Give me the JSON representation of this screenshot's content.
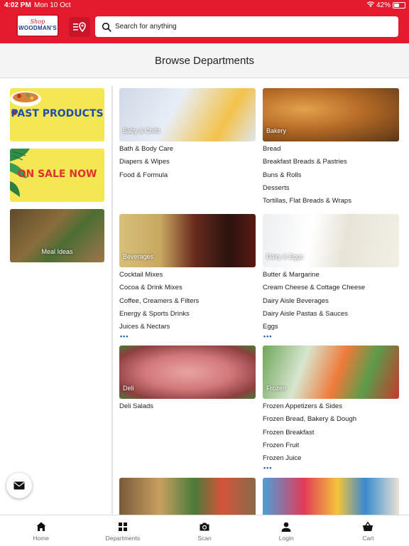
{
  "status_bar": {
    "time": "4:02 PM",
    "date": "Mon 10 Oct",
    "battery": "42%"
  },
  "header": {
    "logo": {
      "tagline": "Shop",
      "brand": "WOODMAN'S"
    },
    "search": {
      "placeholder": "Search for anything"
    }
  },
  "page_title": "Browse Departments",
  "sidebar": {
    "promos": [
      {
        "label": "PAST PRODUCTS",
        "color": "#1e4fb0"
      },
      {
        "label": "ON SALE NOW",
        "color": "#e0302f"
      }
    ],
    "meal_ideas": {
      "label": "Meal Ideas"
    }
  },
  "departments": [
    {
      "name": "Baby & Child",
      "items": [
        "Bath & Body Care",
        "Diapers & Wipes",
        "Food & Formula"
      ],
      "more": ""
    },
    {
      "name": "Bakery",
      "items": [
        "Bread",
        "Breakfast Breads & Pastries",
        "Buns & Rolls",
        "Desserts",
        "Tortillas, Flat Breads & Wraps"
      ],
      "more": ""
    },
    {
      "name": "Beverages",
      "items": [
        "Cocktail Mixes",
        "Cocoa & Drink Mixes",
        "Coffee, Creamers & Filters",
        "Energy & Sports Drinks",
        "Juices & Nectars"
      ],
      "more": "•••"
    },
    {
      "name": "Dairy & Eggs",
      "items": [
        "Butter & Margarine",
        "Cream Cheese & Cottage Cheese",
        "Dairy Aisle Beverages",
        "Dairy Aisle Pastas & Sauces",
        "Eggs"
      ],
      "more": "•••"
    },
    {
      "name": "Deli",
      "items": [
        "Deli Salads"
      ],
      "more": ""
    },
    {
      "name": "Frozen",
      "items": [
        "Frozen Appetizers & Sides",
        "Frozen Bread, Bakery & Dough",
        "Frozen Breakfast",
        "Frozen Fruit",
        "Frozen Juice"
      ],
      "more": "•••"
    }
  ],
  "tabbar": {
    "tabs": [
      {
        "label": "Home",
        "icon": "home-icon"
      },
      {
        "label": "Departments",
        "icon": "grid-icon"
      },
      {
        "label": "Scan",
        "icon": "camera-icon"
      },
      {
        "label": "Login",
        "icon": "person-icon"
      },
      {
        "label": "Cart",
        "icon": "basket-icon"
      }
    ]
  },
  "colors": {
    "brand_red": "#e41b2f",
    "link_blue": "#1c63a8",
    "promo_yellow": "#f5e653"
  }
}
